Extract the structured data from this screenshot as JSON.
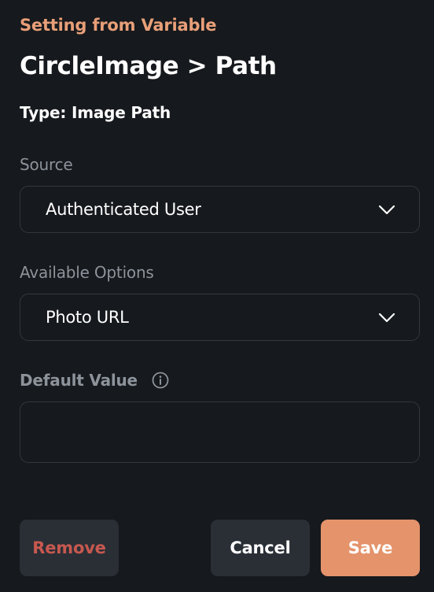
{
  "header": {
    "eyebrow": "Setting from Variable",
    "title": "CircleImage > Path",
    "type_line": "Type: Image Path"
  },
  "source": {
    "label": "Source",
    "value": "Authenticated User",
    "icon": "chevron-down-icon"
  },
  "available_options": {
    "label": "Available Options",
    "value": "Photo URL",
    "icon": "chevron-down-icon"
  },
  "default_value": {
    "label": "Default Value",
    "value": "",
    "placeholder": "",
    "icon": "info-icon"
  },
  "actions": {
    "remove_label": "Remove",
    "cancel_label": "Cancel",
    "save_label": "Save"
  },
  "colors": {
    "accent": "#e4936b",
    "eyebrow": "#e89f78",
    "danger": "#c7584f",
    "background": "#16191d",
    "button_secondary": "#2a2f36",
    "border": "#33373d",
    "muted_text": "#8d939b"
  }
}
